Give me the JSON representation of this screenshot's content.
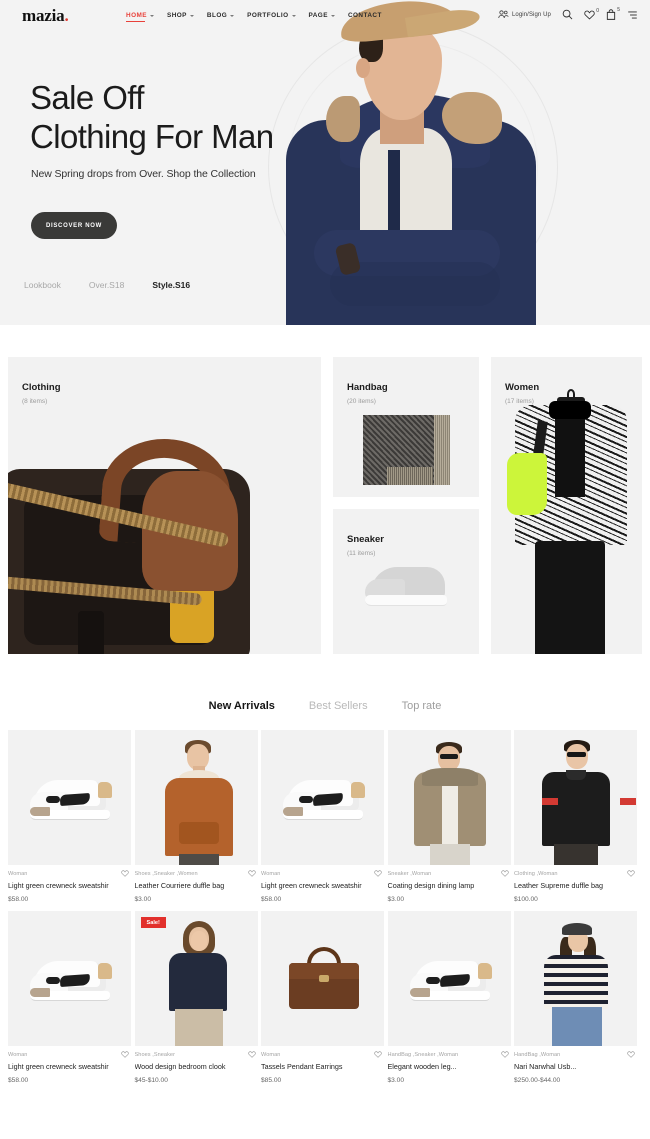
{
  "header": {
    "logo": "mazia",
    "logo_dot": ".",
    "nav": [
      {
        "label": "HOME",
        "caret": true,
        "active": true
      },
      {
        "label": "SHOP",
        "caret": true,
        "active": false
      },
      {
        "label": "BLOG",
        "caret": true,
        "active": false
      },
      {
        "label": "PORTFOLIO",
        "caret": true,
        "active": false
      },
      {
        "label": "PAGE",
        "caret": true,
        "active": false
      },
      {
        "label": "CONTACT",
        "caret": false,
        "active": false
      }
    ],
    "account_label": "Login/Sign Up",
    "wishlist_count": "0",
    "cart_count": "5",
    "accent_color": "#e8413a"
  },
  "hero": {
    "title_line1": "Sale Off",
    "title_line2": "Clothing For Man",
    "subtitle": "New Spring drops from Over. Shop the Collection",
    "button": "DISCOVER NOW",
    "links": [
      {
        "label": "Lookbook",
        "active": false
      },
      {
        "label": "Over.S18",
        "active": false
      },
      {
        "label": "Style.S16",
        "active": true
      }
    ]
  },
  "categories": [
    {
      "title": "Clothing",
      "count": "(8 items)"
    },
    {
      "title": "Handbag",
      "count": "(20 items)"
    },
    {
      "title": "Sneaker",
      "count": "(11 items)"
    },
    {
      "title": "Women",
      "count": "(17 items)"
    }
  ],
  "tabs": [
    {
      "label": "New Arrivals",
      "active": true
    },
    {
      "label": "Best Sellers",
      "active": false
    },
    {
      "label": "Top rate",
      "active": false
    }
  ],
  "products_row1": [
    {
      "category": "Woman",
      "title": "Light green crewneck sweatshir",
      "price": "$58.00",
      "sale": false
    },
    {
      "category": "Shoes ,Sneaker ,Women",
      "title": "Leather Courriere duffle bag",
      "price": "$3.00",
      "sale": false
    },
    {
      "category": "Woman",
      "title": "Light green crewneck sweatshir",
      "price": "$58.00",
      "sale": false
    },
    {
      "category": "Sneaker ,Woman",
      "title": "Coating design dining lamp",
      "price": "$3.00",
      "sale": false
    },
    {
      "category": "Clothing ,Woman",
      "title": "Leather Supreme duffle bag",
      "price": "$100.00",
      "sale": false
    }
  ],
  "products_row2": [
    {
      "category": "Woman",
      "title": "Light green crewneck sweatshir",
      "price": "$58.00",
      "sale": false
    },
    {
      "category": "Shoes ,Sneaker",
      "title": "Wood design bedroom clook",
      "price": "$45-$10.00",
      "sale": true,
      "sale_label": "Sale!"
    },
    {
      "category": "Woman",
      "title": "Tassels Pendant Earrings",
      "price": "$85.00",
      "sale": false
    },
    {
      "category": "HandBag ,Sneaker ,Woman",
      "title": "Elegant wooden leg...",
      "price": "$3.00",
      "sale": false
    },
    {
      "category": "HandBag ,Woman",
      "title": "Nari Narwhal Usb...",
      "price": "$250.00-$44.00",
      "sale": false
    }
  ],
  "icons": {
    "account": "user-icon",
    "search": "search-icon",
    "wishlist": "heart-icon",
    "cart": "bag-icon",
    "menu": "menu-icon",
    "favorite": "heart-outline-icon"
  }
}
